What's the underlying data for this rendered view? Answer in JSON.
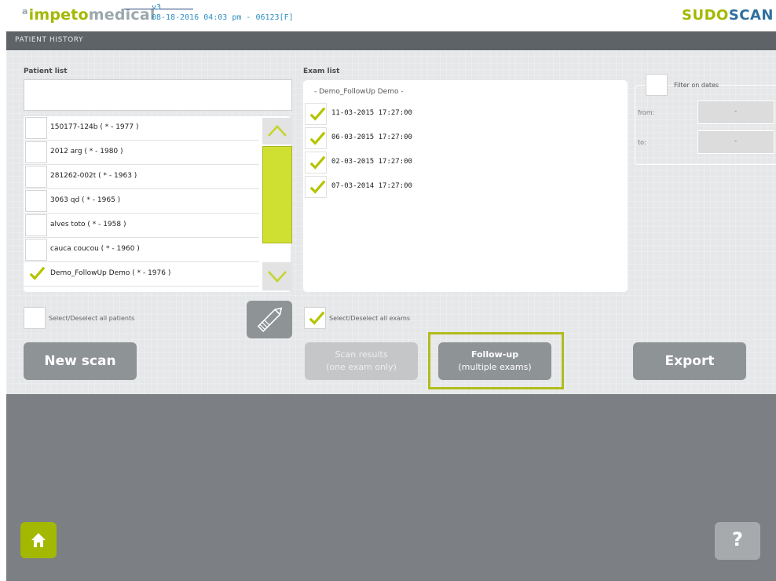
{
  "header": {
    "brand_prefix": "impeto",
    "brand_suffix": "medical",
    "version": "v3",
    "status_line": "08-18-2016 04:03 pm - 06123[F]",
    "product_part1": "SUDO",
    "product_part2": "SCAN"
  },
  "page_title": "PATIENT HISTORY",
  "patients": {
    "label": "Patient list",
    "search_value": "",
    "items": [
      {
        "name": "150177-124b ( * - 1977 )",
        "checked": false
      },
      {
        "name": "2012 arg ( * - 1980 )",
        "checked": false
      },
      {
        "name": "281262-002t  ( * - 1963 )",
        "checked": false
      },
      {
        "name": "3063 qd ( * - 1965 )",
        "checked": false
      },
      {
        "name": "alves toto ( * - 1958 )",
        "checked": false
      },
      {
        "name": "cauca coucou ( * - 1960 )",
        "checked": false
      },
      {
        "name": "Demo_FollowUp Demo ( * - 1976 )",
        "checked": true
      }
    ],
    "select_all_label": "Select/Deselect all patients"
  },
  "exams": {
    "label": "Exam list",
    "group_header": "- Demo_FollowUp Demo -",
    "items": [
      {
        "date": "11-03-2015 17:27:00",
        "checked": true
      },
      {
        "date": "06-03-2015 17:27:00",
        "checked": true
      },
      {
        "date": "02-03-2015 17:27:00",
        "checked": true
      },
      {
        "date": "07-03-2014 17:27:00",
        "checked": true
      }
    ],
    "select_all_label": "Select/Deselect all exams"
  },
  "filter": {
    "label": "Filter on dates",
    "from_label": "from:",
    "to_label": "to:",
    "from_value": "-",
    "to_value": "-"
  },
  "buttons": {
    "new_scan": "New scan",
    "scan_results_line1": "Scan results",
    "scan_results_line2": "(one exam only)",
    "followup_line1": "Follow-up",
    "followup_line2": "(multiple exams)",
    "export": "Export",
    "help": "?"
  },
  "colors": {
    "accent_green": "#a3b800",
    "panel_gray": "#5e6368",
    "button_gray": "#8e9396"
  }
}
